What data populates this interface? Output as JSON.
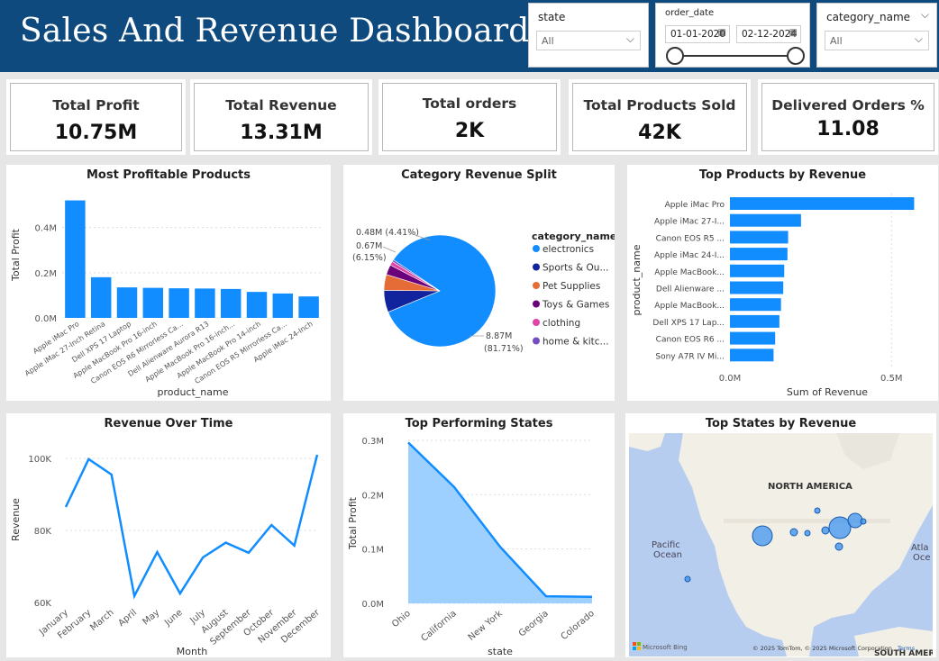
{
  "header": {
    "title": "Sales And Revenue Dashboard"
  },
  "filters": {
    "state": {
      "label": "state",
      "value": "All"
    },
    "order_date": {
      "label": "order_date",
      "start": "01-01-2020",
      "end": "02-12-2024"
    },
    "category_name": {
      "label": "category_name",
      "value": "All"
    }
  },
  "kpis": [
    {
      "label": "Total Profit",
      "value": "10.75M"
    },
    {
      "label": "Total Revenue",
      "value": "13.31M"
    },
    {
      "label": "Total orders",
      "value": "2K"
    },
    {
      "label": "Total Products Sold",
      "value": "42K"
    },
    {
      "label": "Delivered Orders %",
      "value": "11.08"
    }
  ],
  "colors": {
    "header": "#0f4a7f",
    "accent": "#118dff",
    "area": "#9dd0ff"
  },
  "chart_data": [
    {
      "type": "bar",
      "title": "Most Profitable Products",
      "xlabel": "product_name",
      "ylabel": "Total Profit",
      "ylim": [
        0,
        0.55
      ],
      "yticks": [
        "0.0M",
        "0.2M",
        "0.4M"
      ],
      "categories": [
        "Apple iMac Pro",
        "Apple iMac 27-Inch Retina",
        "Dell XPS 17 Laptop",
        "Apple MacBook Pro 16-inch",
        "Canon EOS R6 Mirrorless Ca...",
        "Dell Alienware Aurora R13",
        "Apple MacBook Pro 16-inch...",
        "Apple MacBook Pro 14-inch",
        "Canon EOS R5 Mirrorless Ca...",
        "Apple iMac 24-Inch"
      ],
      "values": [
        0.52,
        0.18,
        0.135,
        0.133,
        0.131,
        0.13,
        0.128,
        0.115,
        0.108,
        0.095
      ]
    },
    {
      "type": "pie",
      "title": "Category Revenue Split",
      "legend_title": "category_name",
      "categories": [
        "electronics",
        "Sports & Ou...",
        "Pet Supplies",
        "Toys & Games",
        "clothing",
        "home & kitc..."
      ],
      "values": [
        8.87,
        0.67,
        0.48,
        0.31,
        0.12,
        0.06
      ],
      "colors": [
        "#118dff",
        "#12239e",
        "#e66c37",
        "#6b007b",
        "#e044a7",
        "#744ec2"
      ],
      "data_labels": [
        "8.87M",
        "(81.71%)",
        "0.67M",
        "(6.15%)",
        "0.48M (4.41%)"
      ]
    },
    {
      "type": "bar",
      "orientation": "horizontal",
      "title": "Top Products by Revenue",
      "xlabel": "Sum of Revenue",
      "ylabel": "product_name",
      "xlim": [
        0,
        0.58
      ],
      "xticks": [
        "0.0M",
        "0.5M"
      ],
      "categories": [
        "Apple iMac Pro",
        "Apple iMac 27-I...",
        "Canon EOS R5 ...",
        "Apple iMac 24-I...",
        "Apple MacBook...",
        "Dell Alienware ...",
        "Apple MacBook...",
        "Dell XPS 17 Lap...",
        "Canon EOS R6 ...",
        "Sony A7R IV Mi..."
      ],
      "values": [
        0.57,
        0.22,
        0.18,
        0.178,
        0.168,
        0.165,
        0.158,
        0.153,
        0.14,
        0.135
      ]
    },
    {
      "type": "line",
      "title": "Revenue Over Time",
      "xlabel": "Month",
      "ylabel": "Revenue",
      "ylim": [
        60000,
        104000
      ],
      "yticks": [
        "60K",
        "80K",
        "100K"
      ],
      "categories": [
        "January",
        "February",
        "March",
        "April",
        "May",
        "June",
        "July",
        "August",
        "September",
        "October",
        "November",
        "December"
      ],
      "values": [
        86500,
        99800,
        95500,
        61800,
        74000,
        62500,
        72500,
        76600,
        73800,
        81500,
        75800,
        101000
      ]
    },
    {
      "type": "area",
      "title": "Top Performing States",
      "xlabel": "state",
      "ylabel": "Total Profit",
      "ylim": [
        0,
        0.3
      ],
      "yticks": [
        "0.0M",
        "0.1M",
        "0.2M",
        "0.3M"
      ],
      "categories": [
        "Ohio",
        "California",
        "New York",
        "Georgia",
        "Colorado"
      ],
      "values": [
        0.296,
        0.214,
        0.104,
        0.013,
        0.012
      ]
    }
  ],
  "map": {
    "title": "Top States by Revenue",
    "labels": {
      "continent": "NORTH AMERICA",
      "ocean_left_1": "Pacific",
      "ocean_left_2": "Ocean",
      "ocean_right_1": "Atla",
      "ocean_right_2": "Oce",
      "south": "SOUTH AMER"
    },
    "attribution": "© 2025 TomTom, © 2025 Microsoft Corporation",
    "terms": "Terms",
    "logo": "Microsoft Bing"
  }
}
